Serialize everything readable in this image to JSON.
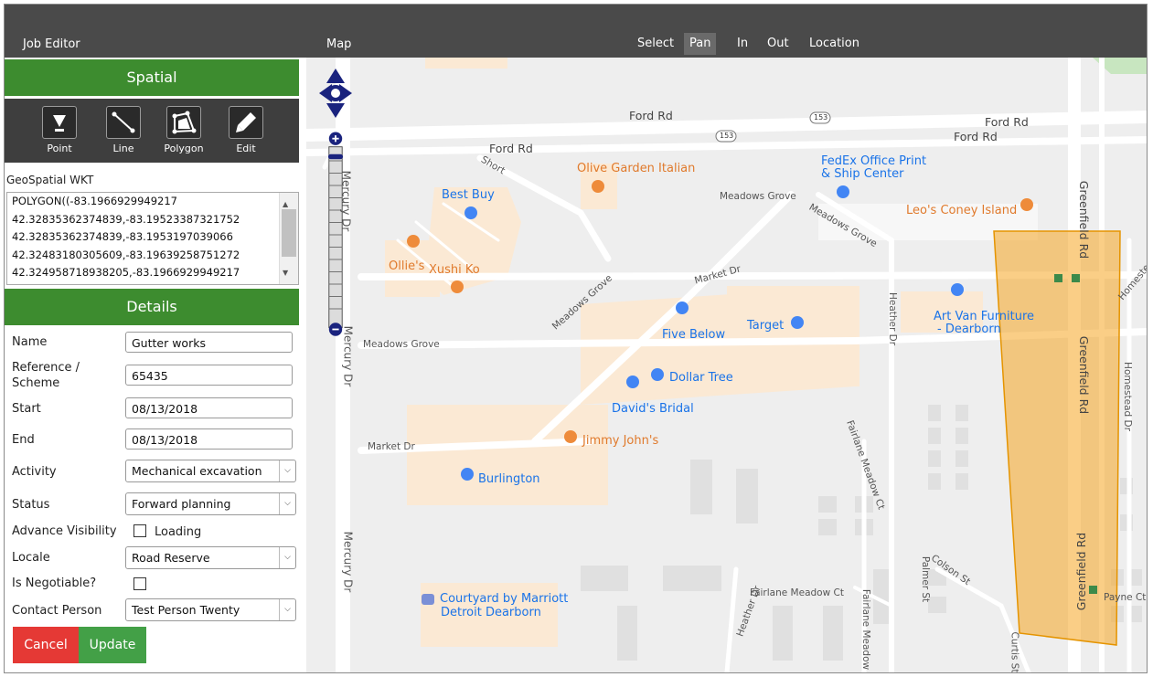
{
  "topbar": {
    "job_editor_title": "Job Editor",
    "map_title": "Map",
    "tools": [
      "Select",
      "Pan",
      "In",
      "Out",
      "Location"
    ],
    "active_tool": "Pan"
  },
  "spatial": {
    "header": "Spatial",
    "tools": [
      {
        "label": "Point",
        "icon": "point-marker-icon"
      },
      {
        "label": "Line",
        "icon": "line-icon"
      },
      {
        "label": "Polygon",
        "icon": "polygon-icon"
      },
      {
        "label": "Edit",
        "icon": "pencil-icon"
      }
    ],
    "wkt_label": "GeoSpatial WKT",
    "wkt_lines": [
      "POLYGON((-83.1966929949217",
      "42.32835362374839,-83.19523387321752",
      "42.32835362374839,-83.1953197039066",
      "42.32483180305609,-83.19639258751272",
      "42.324958718938205,-83.1966929949217"
    ]
  },
  "details": {
    "header": "Details",
    "name_label": "Name",
    "name_value": "Gutter works",
    "reference_label_1": "Reference /",
    "reference_label_2": "Scheme",
    "reference_value": "65435",
    "start_label": "Start",
    "start_value": "08/13/2018",
    "end_label": "End",
    "end_value": "08/13/2018",
    "activity_label": "Activity",
    "activity_value": "Mechanical excavation",
    "status_label": "Status",
    "status_value": "Forward planning",
    "advance_visibility_label": "Advance Visibility",
    "advance_visibility_text": "Loading",
    "locale_label": "Locale",
    "locale_value": "Road Reserve",
    "negotiable_label": "Is Negotiable?",
    "contact_label": "Contact Person",
    "contact_value": "Test Person Twenty",
    "cancel_label": "Cancel",
    "update_label": "Update"
  },
  "map": {
    "roads": {
      "ford_rd_1": "Ford Rd",
      "ford_rd_2": "Ford Rd",
      "ford_rd_3": "Ford Rd",
      "ford_rd_4": "Ford Rd",
      "route_153_a": "153",
      "route_153_b": "153",
      "short": "Short",
      "meadows_grove_1": "Meadows Grove",
      "meadows_grove_2": "Meadows Grove",
      "meadows_grove_3": "Meadows Grove",
      "meadows_grove_4": "Meadows Grove",
      "market_dr_1": "Market Dr",
      "market_dr_2": "Market Dr",
      "mercury_dr_1": "Mercury Dr",
      "mercury_dr_2": "Mercury Dr",
      "mercury_dr_3": "Mercury Dr",
      "heather_dr_1": "Heather Dr",
      "heather_dr_2": "Heather Dr",
      "greenfield_rd_1": "Greenfield Rd",
      "greenfield_rd_2": "Greenfield Rd",
      "greenfield_rd_3": "Greenfield Rd",
      "homestead_1": "Homeste",
      "homestead_dr": "Homestead Dr",
      "fairlane_meadow_ct_1": "Fairlane Meadow Ct",
      "fairlane_meadow_ct_2": "Fairlane Meadow Ct",
      "fairlane_meadow_ct_3": "Fairlane Meadow",
      "colson_st": "Colson St",
      "palmer_st": "Palmer St",
      "curtis_st": "Curtis St",
      "payne_ct": "Payne Ct"
    },
    "pois": {
      "olive_garden": "Olive Garden Italian",
      "fedex": "FedEx Office Print",
      "fedex_2": "& Ship Center",
      "leos": "Leo's Coney Island",
      "best_buy": "Best Buy",
      "ollies": "Ollie's",
      "xushi_ko": "Xushi Ko",
      "art_van": "Art Van Furniture",
      "art_van_2": "- Dearborn",
      "five_below": "Five Below",
      "target": "Target",
      "dollar_tree": "Dollar Tree",
      "davids_bridal": "David's Bridal",
      "jimmy_johns": "Jimmy John's",
      "burlington": "Burlington",
      "courtyard": "Courtyard by Marriott",
      "courtyard_2": "Detroit Dearborn"
    },
    "polygon_fill": "#f5a623"
  },
  "colors": {
    "topbar": "#4a4a4a",
    "section_header": "#3d8c2f",
    "cancel": "#e53935",
    "update": "#43a047",
    "map_nav": "#1a237e"
  }
}
